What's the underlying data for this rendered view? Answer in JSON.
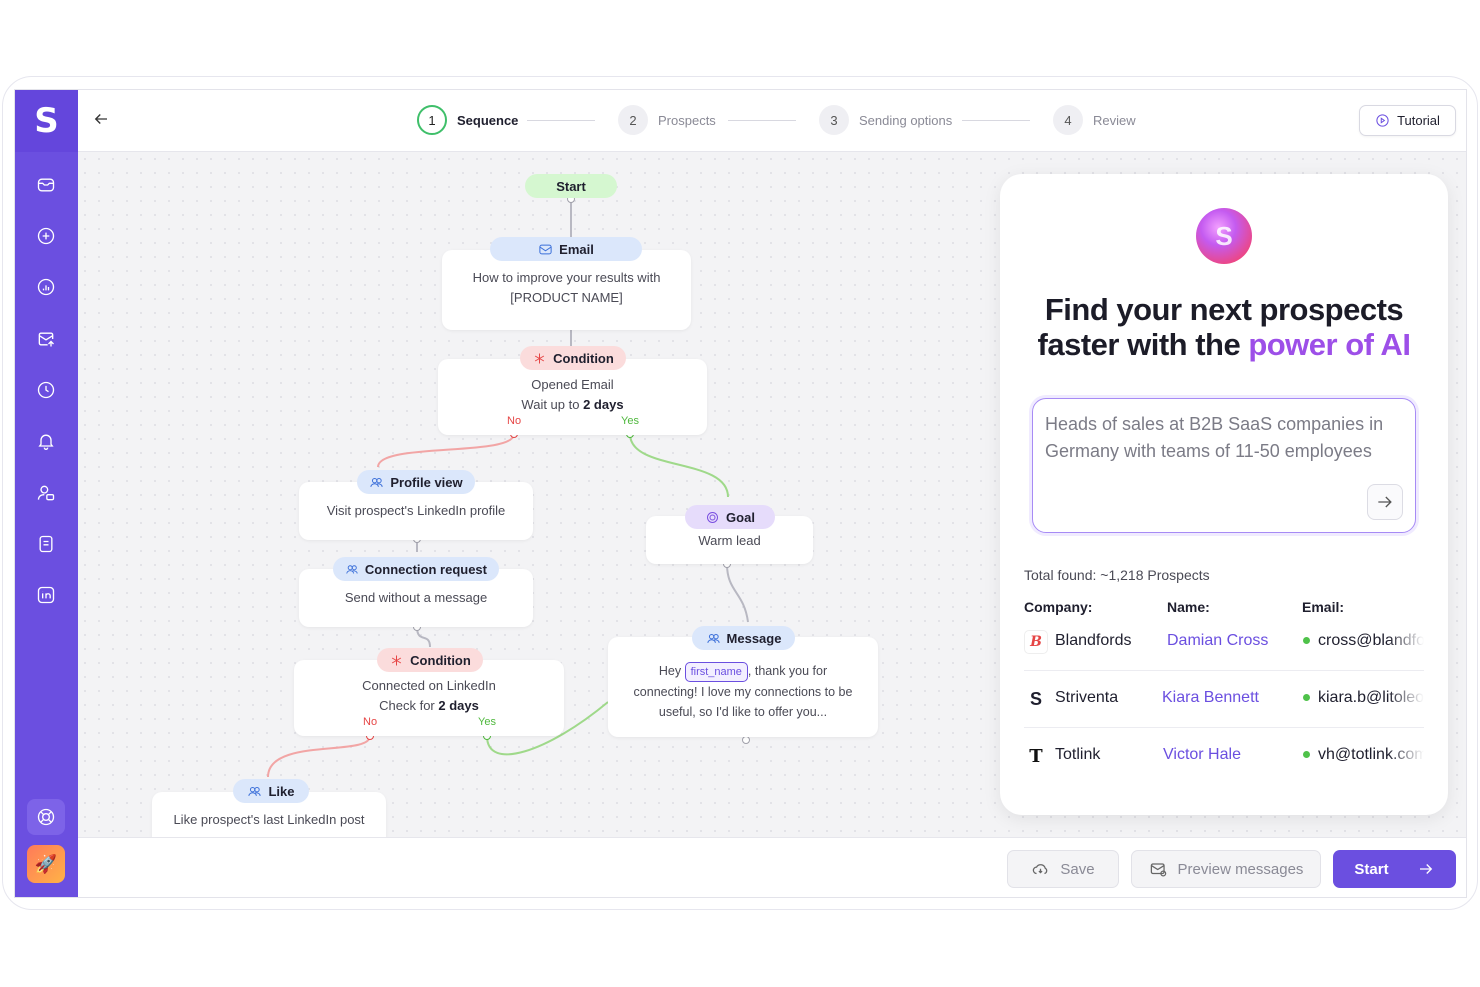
{
  "sidebar": {
    "logo": "S",
    "icons": [
      "mail-icon",
      "add-circle-icon",
      "analytics-icon",
      "outbox-icon",
      "clock-icon",
      "bell-icon",
      "contacts-icon",
      "notes-icon",
      "linkedin-icon"
    ]
  },
  "header": {
    "steps": [
      {
        "num": "1",
        "label": "Sequence"
      },
      {
        "num": "2",
        "label": "Prospects"
      },
      {
        "num": "3",
        "label": "Sending options"
      },
      {
        "num": "4",
        "label": "Review"
      }
    ],
    "tutorial_label": "Tutorial"
  },
  "flow": {
    "start": "Start",
    "email": {
      "title": "Email",
      "body": "How to improve your results with [PRODUCT NAME]"
    },
    "condition1": {
      "title": "Condition",
      "line1": "Opened Email",
      "line2_prefix": "Wait up to ",
      "line2_bold": "2 days",
      "no": "No",
      "yes": "Yes"
    },
    "profile_view": {
      "title": "Profile view",
      "body": "Visit prospect's LinkedIn profile"
    },
    "connection": {
      "title": "Connection request",
      "body": "Send without a message"
    },
    "condition2": {
      "title": "Condition",
      "line1": "Connected on LinkedIn",
      "line2_prefix": "Check for ",
      "line2_bold": "2 days",
      "no": "No",
      "yes": "Yes"
    },
    "like": {
      "title": "Like",
      "body": "Like prospect's last LinkedIn post"
    },
    "goal": {
      "title": "Goal",
      "body": "Warm lead"
    },
    "message": {
      "title": "Message",
      "hey": "Hey",
      "var": "first_name",
      "rest1": ", thank you for",
      "rest2": "connecting! I love my connections to be",
      "rest3": "useful, so I'd like to offer you..."
    }
  },
  "ai_panel": {
    "title_line1": "Find your next prospects",
    "title_line2_plain": "faster with the ",
    "title_line2_accent": "power of AI",
    "query": "Heads of sales at B2B SaaS companies in Germany with teams of 11-50 employees",
    "total": "Total found: ~1,218 Prospects",
    "columns": {
      "company": "Company:",
      "name": "Name:",
      "email": "Email:"
    },
    "rows": [
      {
        "company": "Blandfords",
        "name": "Damian Cross",
        "email": "cross@blandfords.com"
      },
      {
        "company": "Striventa",
        "name": "Kiara Bennett",
        "email": "kiara.b@litoleo.com"
      },
      {
        "company": "Totlink",
        "name": "Victor Hale",
        "email": "vh@totlink.com"
      }
    ]
  },
  "footer": {
    "save": "Save",
    "preview": "Preview messages",
    "start": "Start"
  },
  "colors": {
    "brand": "#6b4fe0",
    "accent_text": "#9d4fe8",
    "success": "#4fb83d",
    "danger": "#e64545"
  }
}
